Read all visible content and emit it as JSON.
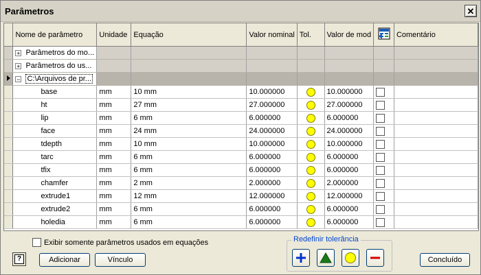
{
  "window": {
    "title": "Parâmetros",
    "close_glyph": "✕"
  },
  "columns": [
    "Nome de parâmetro",
    "Unidade",
    "Equação",
    "Valor nominal",
    "Tol.",
    "Valor de mod",
    "",
    "Comentário"
  ],
  "groups": [
    {
      "name": "Parâmetros do mo...",
      "expander": "+"
    },
    {
      "name": "Parâmetros do us...",
      "expander": "+"
    },
    {
      "name": "C:\\Arquivos de pr...",
      "expander": "−"
    }
  ],
  "params": [
    {
      "name": "base",
      "unit": "mm",
      "eq": "10 mm",
      "nominal": "10.000000",
      "model": "10.000000"
    },
    {
      "name": "ht",
      "unit": "mm",
      "eq": "27 mm",
      "nominal": "27.000000",
      "model": "27.000000"
    },
    {
      "name": "lip",
      "unit": "mm",
      "eq": "6 mm",
      "nominal": "6.000000",
      "model": "6.000000"
    },
    {
      "name": "face",
      "unit": "mm",
      "eq": "24 mm",
      "nominal": "24.000000",
      "model": "24.000000"
    },
    {
      "name": "tdepth",
      "unit": "mm",
      "eq": "10 mm",
      "nominal": "10.000000",
      "model": "10.000000"
    },
    {
      "name": "tarc",
      "unit": "mm",
      "eq": "6 mm",
      "nominal": "6.000000",
      "model": "6.000000"
    },
    {
      "name": "tfix",
      "unit": "mm",
      "eq": "6 mm",
      "nominal": "6.000000",
      "model": "6.000000"
    },
    {
      "name": "chamfer",
      "unit": "mm",
      "eq": "2 mm",
      "nominal": "2.000000",
      "model": "2.000000"
    },
    {
      "name": "extrude1",
      "unit": "mm",
      "eq": "12 mm",
      "nominal": "12.000000",
      "model": "12.000000"
    },
    {
      "name": "extrude2",
      "unit": "mm",
      "eq": "6 mm",
      "nominal": "6.000000",
      "model": "6.000000"
    },
    {
      "name": "holedia",
      "unit": "mm",
      "eq": "6 mm",
      "nominal": "6.000000",
      "model": "6.000000"
    }
  ],
  "bottom": {
    "show_only_label": "Exibir somente parâmetros usados em equações",
    "add_label": "Adicionar",
    "link_label": "Vínculo",
    "tolerance_legend": "Redefinir tolerância",
    "done_label": "Concluído",
    "help_glyph": "?"
  },
  "colors": {
    "tolerance_dot": "#ffff00",
    "plus": "#0033cc",
    "triangle": "#1a7a1a",
    "minus": "#d40000"
  }
}
